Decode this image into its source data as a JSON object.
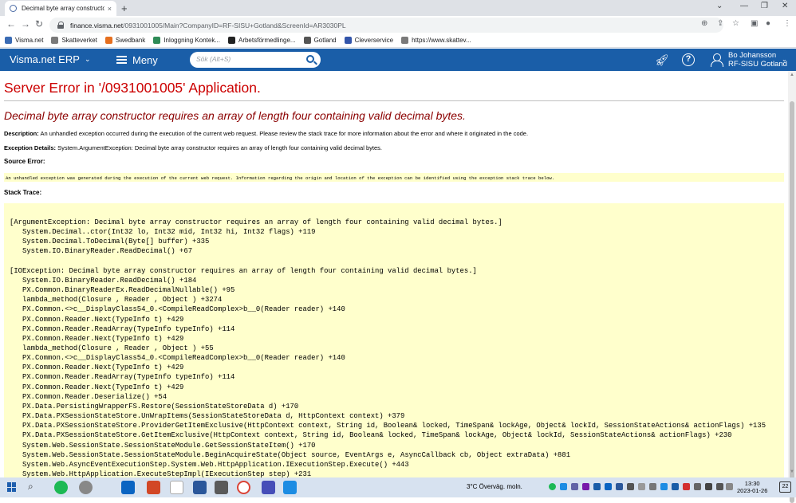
{
  "browser": {
    "tab_title": "Decimal byte array constructor re",
    "tab_close": "×",
    "new_tab": "+",
    "url_host": "finance.visma.net",
    "url_path": "/0931001005/Main?CompanyID=RF-SISU+Gotland&ScreenId=AR3030PL",
    "bookmarks": [
      {
        "label": "Visma.net",
        "color": "#3a6bb4"
      },
      {
        "label": "Skatteverket",
        "color": "#7a7a7a"
      },
      {
        "label": "Swedbank",
        "color": "#e56f1f"
      },
      {
        "label": "Inloggning Kontek...",
        "color": "#2e8b57"
      },
      {
        "label": "Arbetsförmedlinge...",
        "color": "#222222"
      },
      {
        "label": "Gotland",
        "color": "#555555"
      },
      {
        "label": "Cleverservice",
        "color": "#3355aa"
      },
      {
        "label": "https://www.skattev...",
        "color": "#7a7a7a"
      }
    ]
  },
  "app": {
    "brand": "Visma.net ERP",
    "menu_label": "Meny",
    "search_placeholder": "Sök (Alt+S)",
    "user_name": "Bo Johansson",
    "user_company": "RF-SISU Gotland"
  },
  "error": {
    "title": "Server Error in '/0931001005' Application.",
    "message": "Decimal byte array constructor requires an array of length four containing valid decimal bytes.",
    "description_label": "Description:",
    "description_text": "An unhandled exception occurred during the execution of the current web request. Please review the stack trace for more information about the error and where it originated in the code.",
    "exception_label": "Exception Details:",
    "exception_text": "System.ArgumentException: Decimal byte array constructor requires an array of length four containing valid decimal bytes.",
    "source_label": "Source Error:",
    "source_text": "An unhandled exception was generated during the execution of the current web request. Information regarding the origin and location of the exception can be identified using the exception stack trace below.",
    "stack_label": "Stack Trace:",
    "stack_block1": [
      "[ArgumentException: Decimal byte array constructor requires an array of length four containing valid decimal bytes.]",
      "System.Decimal..ctor(Int32 lo, Int32 mid, Int32 hi, Int32 flags) +119",
      "System.Decimal.ToDecimal(Byte[] buffer) +335",
      "System.IO.BinaryReader.ReadDecimal() +67"
    ],
    "stack_block2": [
      "[IOException: Decimal byte array constructor requires an array of length four containing valid decimal bytes.]",
      "System.IO.BinaryReader.ReadDecimal() +184",
      "PX.Common.BinaryReaderEx.ReadDecimalNullable() +95",
      "lambda_method(Closure , Reader , Object ) +3274",
      "PX.Common.<>c__DisplayClass54_0.<CompileReadComplex>b__0(Reader reader) +140",
      "PX.Common.Reader.Next(TypeInfo t) +429",
      "PX.Common.Reader.ReadArray(TypeInfo typeInfo) +114",
      "PX.Common.Reader.Next(TypeInfo t) +429",
      "lambda_method(Closure , Reader , Object ) +55",
      "PX.Common.<>c__DisplayClass54_0.<CompileReadComplex>b__0(Reader reader) +140",
      "PX.Common.Reader.Next(TypeInfo t) +429",
      "PX.Common.Reader.ReadArray(TypeInfo typeInfo) +114",
      "PX.Common.Reader.Next(TypeInfo t) +429",
      "PX.Common.Reader.Deserialize() +54",
      "PX.Data.PersistingWrapperFS.Restore(SessionStateStoreData d) +170",
      "PX.Data.PXSessionStateStore.UnWrapItems(SessionStateStoreData d, HttpContext context) +379",
      "PX.Data.PXSessionStateStore.ProviderGetItemExclusive(HttpContext context, String id, Boolean& locked, TimeSpan& lockAge, Object& lockId, SessionStateActions& actionFlags) +135",
      "PX.Data.PXSessionStateStore.GetItemExclusive(HttpContext context, String id, Boolean& locked, TimeSpan& lockAge, Object& lockId, SessionStateActions& actionFlags) +230",
      "System.Web.SessionState.SessionStateModule.GetSessionStateItem() +170",
      "System.Web.SessionState.SessionStateModule.BeginAcquireState(Object source, EventArgs e, AsyncCallback cb, Object extraData) +881",
      "System.Web.AsyncEventExecutionStep.System.Web.HttpApplication.IExecutionStep.Execute() +443",
      "System.Web.HttpApplication.ExecuteStepImpl(IExecutionStep step) +231"
    ]
  },
  "taskbar": {
    "weather": "3°C  Överväg. moln.",
    "time": "13:30",
    "date": "2023-01-26",
    "notifications": "22"
  }
}
